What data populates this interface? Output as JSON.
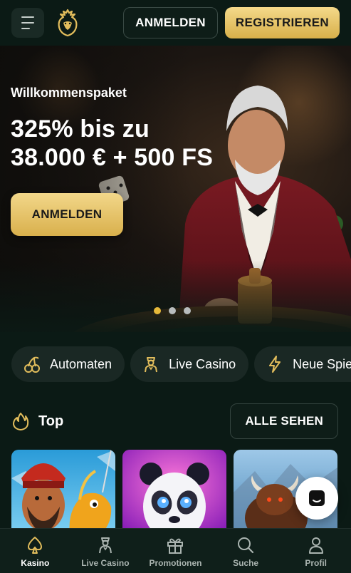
{
  "header": {
    "login_label": "ANMELDEN",
    "register_label": "REGISTRIEREN"
  },
  "hero": {
    "kicker": "Willkommenspaket",
    "title_line1": "325% bis zu",
    "title_line2": "38.000 € + 500 FS",
    "cta_label": "ANMELDEN",
    "slide_count": 3,
    "active_slide": 1
  },
  "categories": [
    {
      "label": "Automaten",
      "icon": "cherries-icon"
    },
    {
      "label": "Live Casino",
      "icon": "dealer-icon"
    },
    {
      "label": "Neue Spiele",
      "icon": "lightning-icon"
    }
  ],
  "top_section": {
    "title": "Top",
    "icon": "flame-icon",
    "see_all_label": "ALLE SEHEN"
  },
  "games": [
    {
      "icon": "fisherman-game-icon"
    },
    {
      "icon": "panda-game-icon"
    },
    {
      "icon": "buffalo-game-icon"
    }
  ],
  "bottom_nav": [
    {
      "label": "Kasino",
      "icon": "spade-icon",
      "active": true
    },
    {
      "label": "Live Casino",
      "icon": "dealer-icon",
      "active": false
    },
    {
      "label": "Promotionen",
      "icon": "gift-icon",
      "active": false
    },
    {
      "label": "Suche",
      "icon": "search-icon",
      "active": false
    },
    {
      "label": "Profil",
      "icon": "user-icon",
      "active": false
    }
  ],
  "colors": {
    "background": "#0b1a15",
    "gold": "#e2bd5c",
    "surface": "#1a2824"
  }
}
